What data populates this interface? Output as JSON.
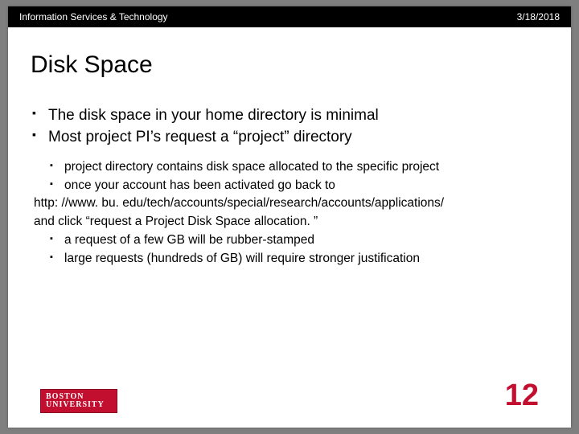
{
  "header": {
    "org": "Information Services & Technology",
    "date": "3/18/2018"
  },
  "title": "Disk Space",
  "bullets": {
    "b1": "The disk space in your home directory is minimal",
    "b2": "Most project PI’s request a “project” directory"
  },
  "sub": {
    "s1": "project directory contains disk space allocated to the specific project",
    "s2": "once your account has been activated go back to",
    "url": "http: //www. bu. edu/tech/accounts/special/research/accounts/applications/",
    "postUrl": "and click “request a Project Disk Space allocation. ”",
    "s3": "a request of a few GB will be rubber-stamped",
    "s4": "large requests (hundreds of GB) will require stronger justification"
  },
  "footer": {
    "logo_line1": "BOSTON",
    "logo_line2": "UNIVERSITY",
    "page": "12"
  }
}
